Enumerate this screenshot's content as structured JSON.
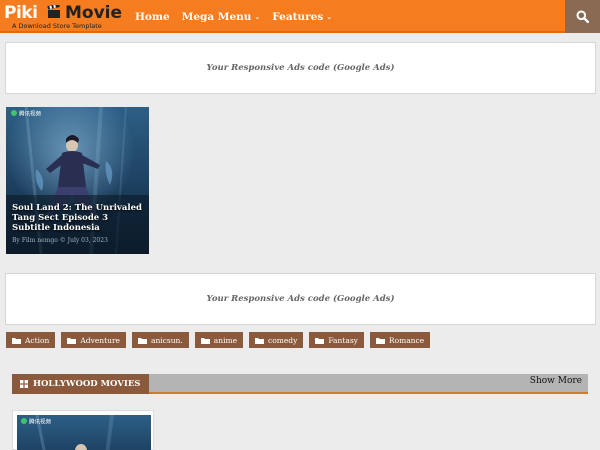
{
  "header": {
    "logo": {
      "piki": "Piki",
      "movie": "Movie",
      "tagline": "A Download Store Template"
    },
    "nav": [
      {
        "label": "Home",
        "has_caret": false
      },
      {
        "label": "Mega Menu",
        "has_caret": true
      },
      {
        "label": "Features",
        "has_caret": true
      }
    ],
    "search_icon": "search-icon"
  },
  "ads": {
    "top": "Your Responsive Ads code (Google Ads)",
    "middle": "Your Responsive Ads code (Google Ads)"
  },
  "post": {
    "thumb_logo_text": "腾讯视频",
    "title": "Soul Land 2: The Unrivaled Tang Sect Episode 3 Subtitle Indonesia",
    "meta": "By Film nemgo © July 03, 2023"
  },
  "labels": [
    "Action",
    "Adventure",
    "anicsun.",
    "anime",
    "comedy",
    "Fantasy",
    "Romance"
  ],
  "section": {
    "title": "HOLLYWOOD MOVIES",
    "show_more": "Show More"
  },
  "post2": {
    "thumb_logo_text": "腾讯视频"
  },
  "colors": {
    "header": "#f57c1f",
    "accent": "#8b5a3c",
    "search_bg": "#8a6a52"
  }
}
